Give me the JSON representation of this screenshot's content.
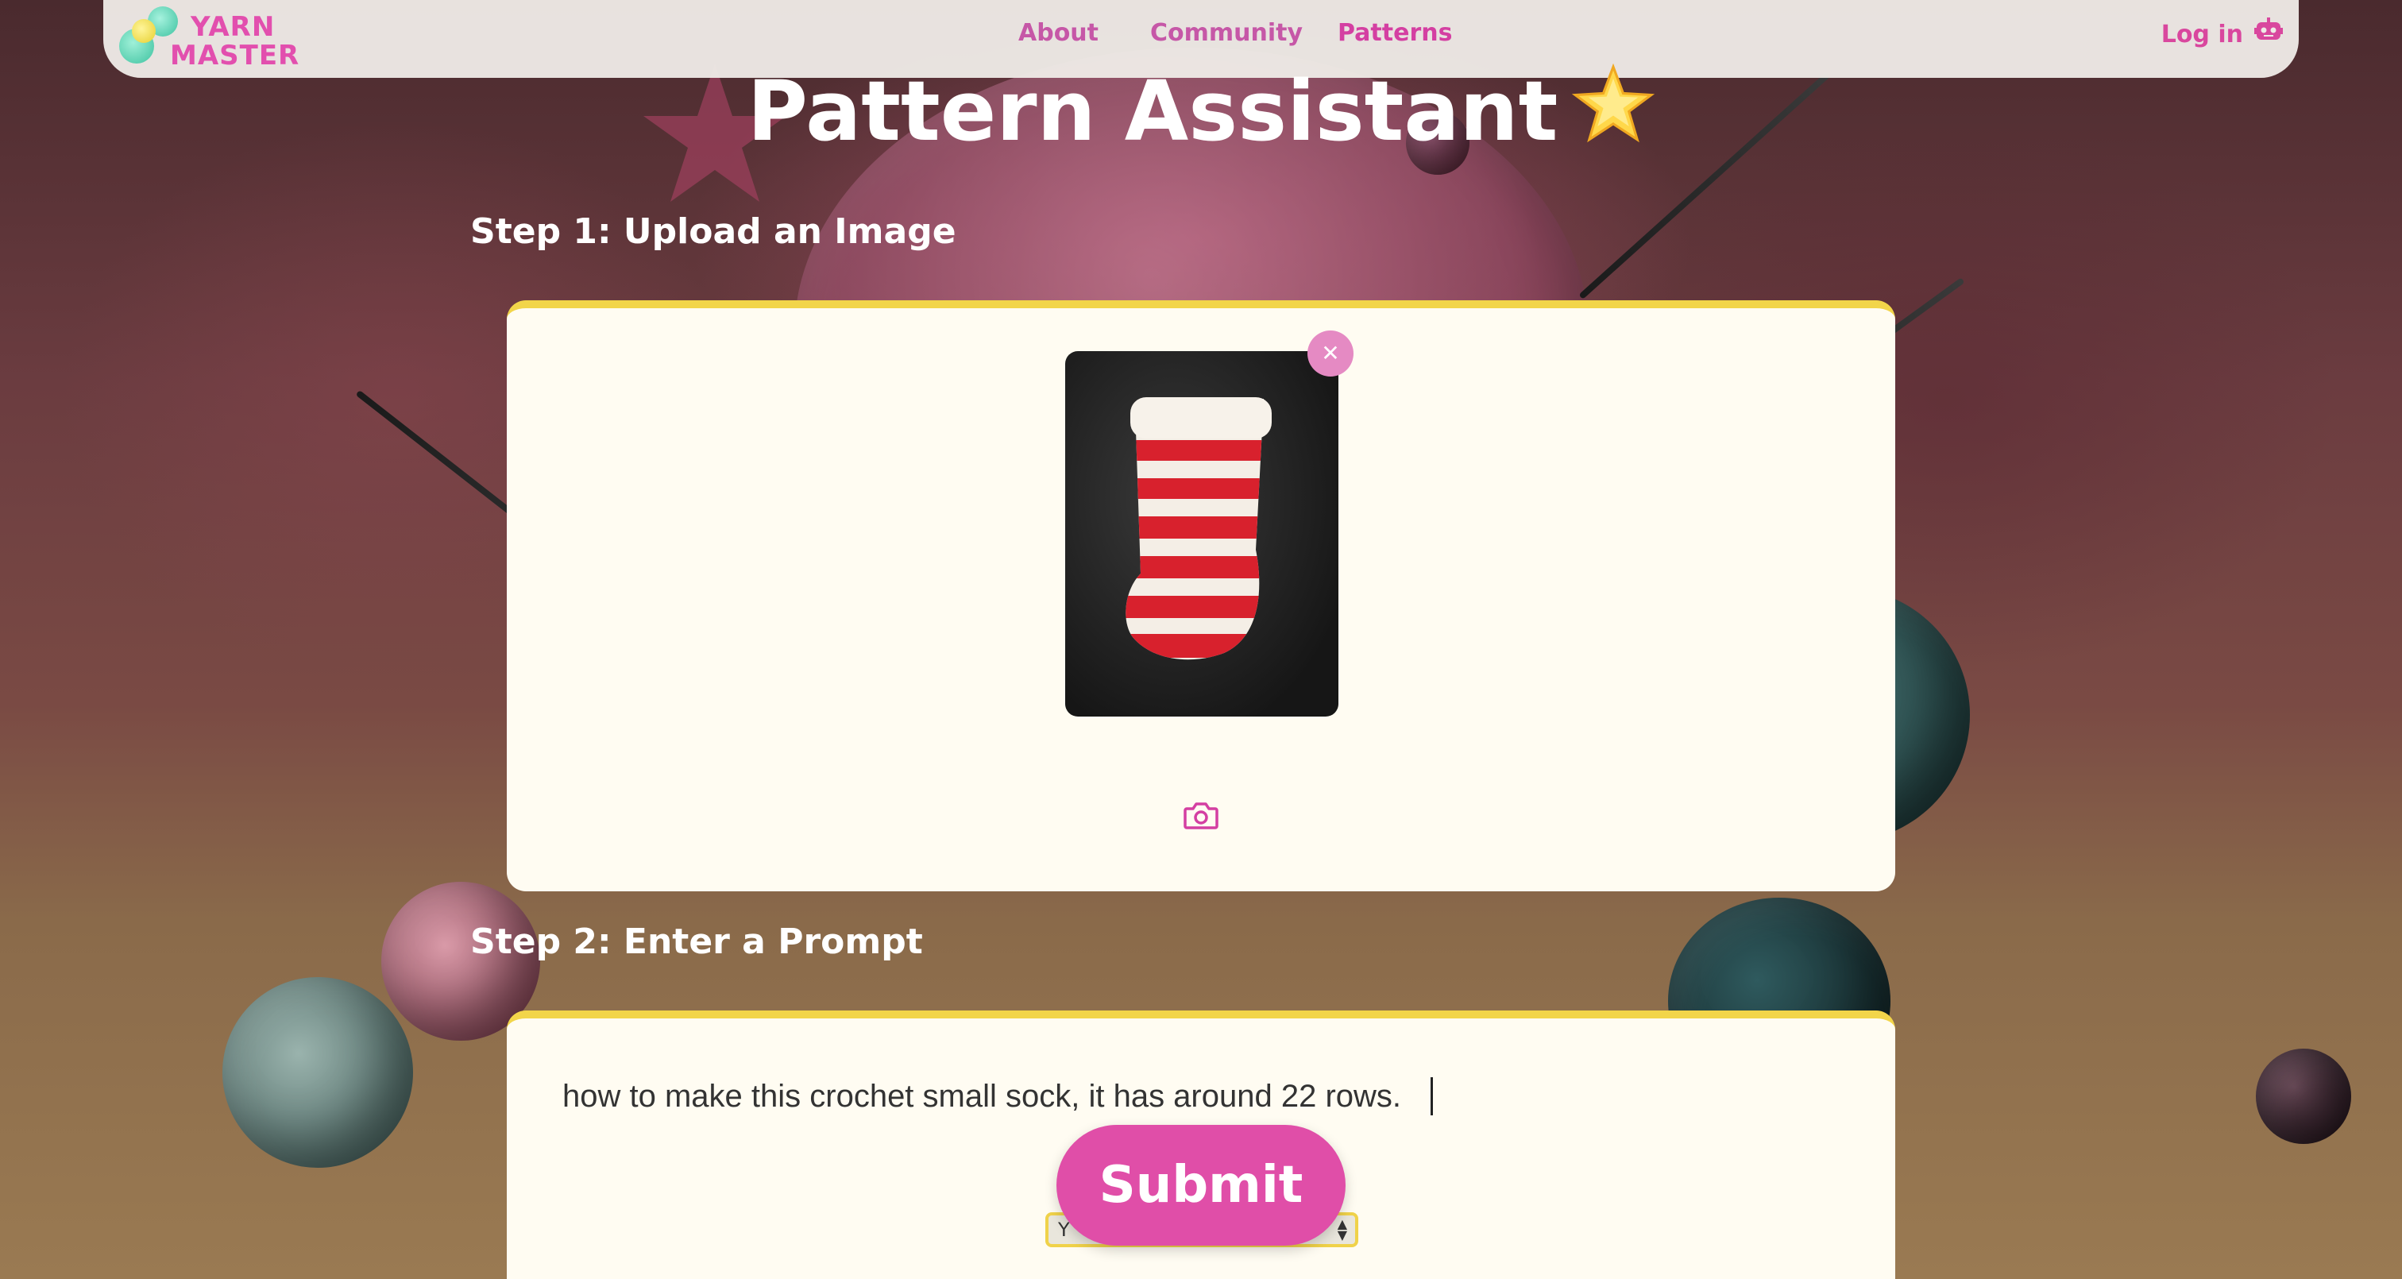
{
  "brand": {
    "line1": "YARN",
    "line2": "MASTER"
  },
  "nav": {
    "links": [
      {
        "label": "About"
      },
      {
        "label": "Community"
      },
      {
        "label": "Patterns"
      }
    ],
    "login_label": "Log in"
  },
  "page": {
    "title": "Pattern Assistant",
    "title_icon": "star-icon"
  },
  "steps": {
    "upload_heading": "Step 1: Upload an Image",
    "prompt_heading": "Step 2: Enter a Prompt"
  },
  "upload": {
    "remove_icon": "close-icon",
    "camera_icon": "camera-icon"
  },
  "prompt": {
    "value": "how to make this crochet small sock, it has around 22 rows.",
    "submit_label": "Submit",
    "select_value": "Y"
  },
  "colors": {
    "accent": "#e04ea8",
    "card_border": "#f2d54a",
    "card_bg": "#fffcf2"
  }
}
